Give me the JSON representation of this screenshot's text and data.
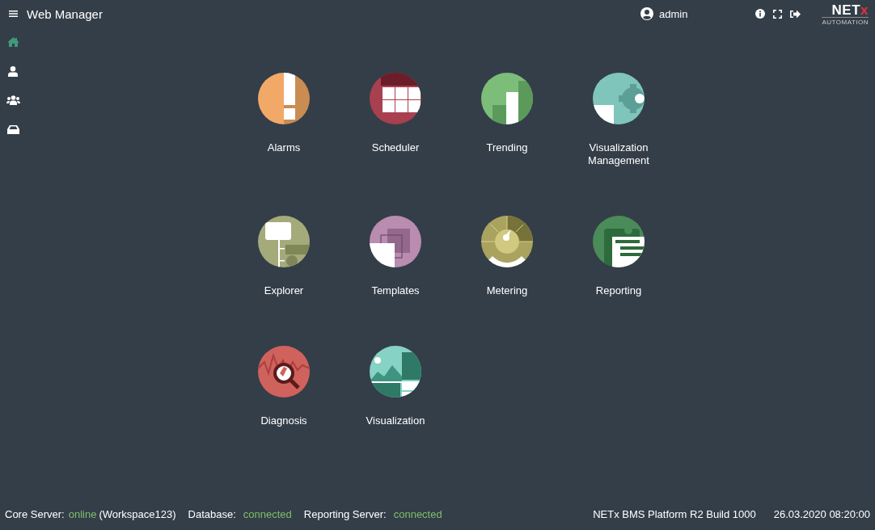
{
  "header": {
    "title": "Web Manager",
    "user": "admin",
    "logo": {
      "text": "NET",
      "accent": "x",
      "subtitle": "AUTOMATION"
    }
  },
  "sidebar": {
    "items": [
      {
        "kind": "home",
        "selected": true
      },
      {
        "kind": "user",
        "selected": false
      },
      {
        "kind": "users",
        "selected": false
      },
      {
        "kind": "drive",
        "selected": false
      }
    ]
  },
  "tiles": [
    {
      "label": "Alarms",
      "kind": "alarm",
      "color": "#f2a968"
    },
    {
      "label": "Scheduler",
      "kind": "calendar",
      "color": "#a8404f"
    },
    {
      "label": "Trending",
      "kind": "trend",
      "color": "#7cbd7a"
    },
    {
      "label": "Visualization Management",
      "kind": "gear",
      "color": "#80c5bc"
    },
    {
      "label": "Explorer",
      "kind": "tree",
      "color": "#a4aa7a"
    },
    {
      "label": "Templates",
      "kind": "layers",
      "color": "#b98cb0"
    },
    {
      "label": "Metering",
      "kind": "meter",
      "color": "#a9a35f"
    },
    {
      "label": "Reporting",
      "kind": "clipboard",
      "color": "#4b8b59"
    },
    {
      "label": "Diagnosis",
      "kind": "magnifier",
      "color": "#cf625c"
    },
    {
      "label": "Visualization",
      "kind": "picture",
      "color": "#86d2c4"
    }
  ],
  "status_bar": {
    "items": [
      {
        "label": "Core Server:",
        "value": "online",
        "extra": "(Workspace123)"
      },
      {
        "label": "Database:",
        "value": "connected"
      },
      {
        "label": "Reporting Server:",
        "value": "connected"
      }
    ],
    "build": "NETx BMS Platform R2 Build 1000",
    "datetime": "26.03.2020 08:20:00"
  }
}
